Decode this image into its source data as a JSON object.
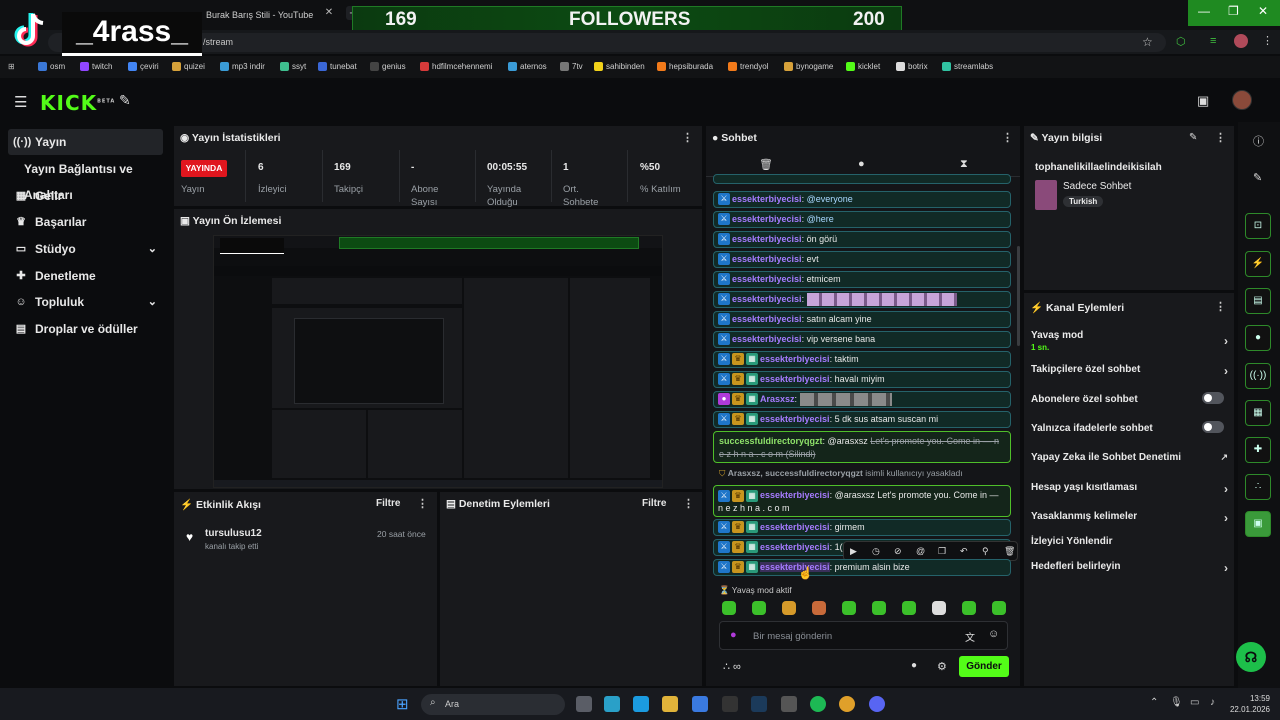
{
  "browser": {
    "tab_title": "Burak Barış Stili - YouTube",
    "url": "/stream",
    "bookmarks": [
      "osm",
      "twitch",
      "çeviri",
      "quizei",
      "mp3 indir",
      "ssyt",
      "tunebat",
      "genius",
      "hdfilmcehennemi",
      "aternos",
      "7tv",
      "sahibinden",
      "hepsiburada",
      "trendyol",
      "bynogame",
      "kicklet",
      "botrix",
      "streamlabs"
    ]
  },
  "overlay": {
    "tiktok_name": "_4rass_",
    "follower_left": "169",
    "follower_label": "FOLLOWERS",
    "follower_right": "200"
  },
  "kick": {
    "logo": "KICK",
    "logo_sup": "BETA"
  },
  "sidebar": {
    "items": [
      {
        "label": "Yayın",
        "icon": "broadcast-icon"
      },
      {
        "label": "Yayın Bağlantısı ve Anahtarı",
        "icon": ""
      },
      {
        "label": "Gelir",
        "icon": "dollar-icon"
      },
      {
        "label": "Başarılar",
        "icon": "trophy-icon"
      },
      {
        "label": "Stüdyo",
        "icon": "studio-icon"
      },
      {
        "label": "Denetleme",
        "icon": "wrench-icon"
      },
      {
        "label": "Topluluk",
        "icon": "people-icon"
      },
      {
        "label": "Droplar ve ödüller",
        "icon": "drops-icon"
      }
    ]
  },
  "stats": {
    "title": "Yayın İstatistikleri",
    "live_badge": "YAYINDA",
    "live_label": "Yayın",
    "items": [
      {
        "value": "6",
        "label": "İzleyici"
      },
      {
        "value": "169",
        "label": "Takipçi"
      },
      {
        "value": "-",
        "label": "Abone Sayısı"
      },
      {
        "value": "00:05:55",
        "label": "Yayında Olduğu"
      },
      {
        "value": "1",
        "label": "Ort. Sohbete"
      },
      {
        "value": "%50",
        "label": "% Katılım"
      }
    ]
  },
  "preview": {
    "title": "Yayın Ön İzlemesi"
  },
  "activity": {
    "title": "Etkinlik Akışı",
    "filter": "Filtre",
    "entry_user": "tursulusu12",
    "entry_text": "kanalı takip etti",
    "entry_time": "20 saat önce"
  },
  "moderation": {
    "title": "Denetim Eylemleri",
    "filter": "Filtre"
  },
  "chat": {
    "title": "Sohbet",
    "messages": [
      {
        "user": "essekterbiyecisi",
        "text": "@everyone"
      },
      {
        "user": "essekterbiyecisi",
        "text": "@here"
      },
      {
        "user": "essekterbiyecisi",
        "text": "ön görü"
      },
      {
        "user": "essekterbiyecisi",
        "text": "evt"
      },
      {
        "user": "essekterbiyecisi",
        "text": "etmicem"
      },
      {
        "user": "essekterbiyecisi",
        "text": ""
      },
      {
        "user": "essekterbiyecisi",
        "text": "satın alcam yine"
      },
      {
        "user": "essekterbiyecisi",
        "text": "vip versene bana"
      },
      {
        "user": "essekterbiyecisi",
        "text": "taktim"
      },
      {
        "user": "essekterbiyecisi",
        "text": "havalı miyim"
      },
      {
        "user": "Arasxsz",
        "text": ""
      },
      {
        "user": "essekterbiyecisi",
        "text": "5 dk sus atsam suscan mi"
      }
    ],
    "deleted_user": "successfuldirectoryqgzt",
    "deleted_mention": "@arasxsz",
    "deleted_text": "Let's promote you. Come in — n e z h n a . c o m (Silindi)",
    "ban_notice_users": "Arasxsz, successfuldirectoryqgzt",
    "ban_notice_text": "isimli kullanıcıyı yasakladı",
    "hl_user": "essekterbiyecisi",
    "hl_text": "@arasxsz Let's promote you. Come in — n e z h n a . c o m",
    "after": [
      {
        "user": "essekterbiyecisi",
        "text": "girmem"
      },
      {
        "user": "essekterbiyecisi",
        "text": "1("
      },
      {
        "user": "essekterbiyecisi",
        "text": "premium alsin bize"
      }
    ],
    "slow_mode": "Yavaş mod aktif",
    "input_placeholder": "Bir mesaj gönderin",
    "send": "Gönder"
  },
  "stream_info": {
    "title": "Yayın bilgisi",
    "stream_title": "tophanelikillaelindeikisilah",
    "category": "Sadece Sohbet",
    "tag": "Turkish"
  },
  "channel_actions": {
    "title": "Kanal Eylemleri",
    "items": [
      {
        "label": "Yavaş mod",
        "sub": "1 sn.",
        "ctrl": "chevron"
      },
      {
        "label": "Takipçilere özel sohbet",
        "sub": "",
        "ctrl": "chevron"
      },
      {
        "label": "Abonelere özel sohbet",
        "sub": "",
        "ctrl": "toggle"
      },
      {
        "label": "Yalnızca ifadelerle sohbet",
        "sub": "",
        "ctrl": "toggle"
      },
      {
        "label": "Yapay Zeka ile Sohbet Denetimi",
        "sub": "",
        "ctrl": "external"
      },
      {
        "label": "Hesap yaşı kısıtlaması",
        "sub": "",
        "ctrl": "chevron"
      },
      {
        "label": "Yasaklanmış kelimeler",
        "sub": "",
        "ctrl": "chevron"
      },
      {
        "label": "İzleyici Yönlendir",
        "sub": "",
        "ctrl": ""
      },
      {
        "label": "Hedefleri belirleyin",
        "sub": "",
        "ctrl": "chevron"
      }
    ]
  },
  "taskbar": {
    "search": "Ara",
    "time": "13:59",
    "date": "22.01.2026"
  },
  "colors": {
    "kick_green": "#53fc18",
    "live_red": "#e0161e",
    "username_purple": "#a67bff"
  }
}
